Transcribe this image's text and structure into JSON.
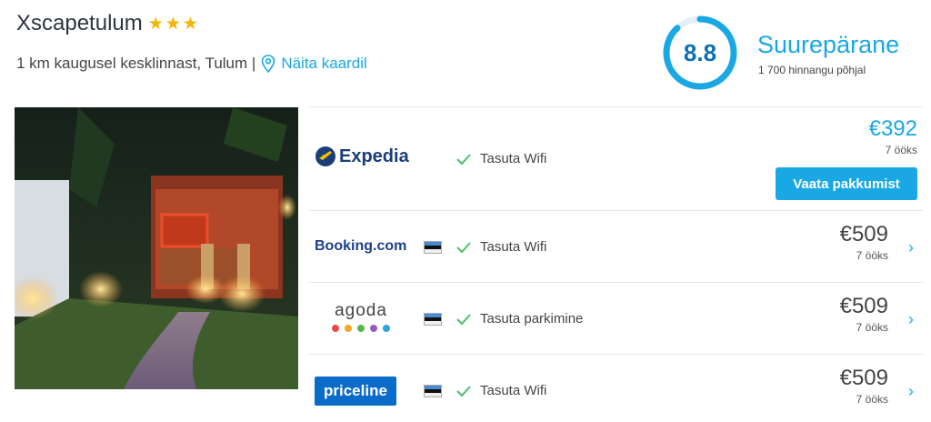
{
  "hotel": {
    "name": "Xscapetulum",
    "star_count": 3,
    "stars": [
      "★",
      "★",
      "★"
    ],
    "location_text": "1 km kaugusel kesklinnast, Tulum |",
    "map_link": "Näita kaardil"
  },
  "rating": {
    "score": "8.8",
    "score_fraction": 0.88,
    "label": "Suurepärane",
    "count_text": "1 700 hinnangu põhjal",
    "color": "#1aa8e4"
  },
  "offers": [
    {
      "provider": "Expedia",
      "perk": "Tasuta Wifi",
      "price": "€392",
      "nights": "7 ööks",
      "button": "Vaata pakkumist"
    },
    {
      "provider": "Booking.com",
      "perk": "Tasuta Wifi",
      "price": "€509",
      "nights": "7 ööks"
    },
    {
      "provider": "agoda",
      "perk": "Tasuta parkimine",
      "price": "€509",
      "nights": "7 ööks"
    },
    {
      "provider": "priceline",
      "perk": "Tasuta Wifi",
      "price": "€509",
      "nights": "7 ööks"
    }
  ],
  "colors": {
    "accent": "#1aa8e4",
    "star": "#f5b400",
    "check": "#4cbf6a"
  }
}
